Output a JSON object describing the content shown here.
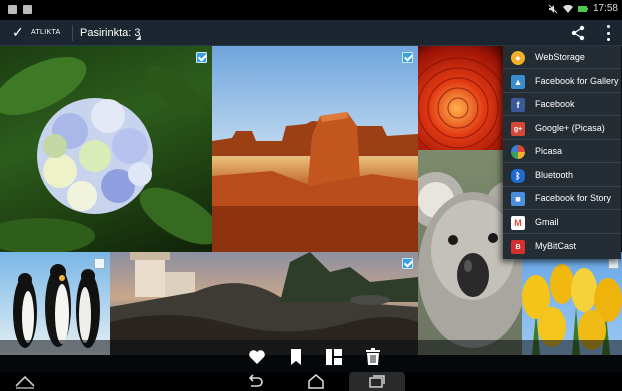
{
  "status_bar": {
    "time": "17:58"
  },
  "action_bar": {
    "done_label": "ATLIKTA",
    "selection_label": "Pasirinkta: 3"
  },
  "photos": [
    {
      "subject": "Hydrangea",
      "selected": true
    },
    {
      "subject": "Desert",
      "selected": true
    },
    {
      "subject": "Chrysanthemum",
      "selected": false
    },
    {
      "subject": "Koala",
      "selected": false
    },
    {
      "subject": "Penguins",
      "selected": false
    },
    {
      "subject": "Lighthouse",
      "selected": true
    },
    {
      "subject": "Tulips",
      "selected": false
    }
  ],
  "share_menu": {
    "items": [
      {
        "label": "WebStorage",
        "icon": "webstorage-icon",
        "color": "#f2b02a"
      },
      {
        "label": "Facebook for Gallery",
        "icon": "gallery-icon",
        "color": "#3b8ccf"
      },
      {
        "label": "Facebook",
        "icon": "facebook-icon",
        "color": "#3b5998"
      },
      {
        "label": "Google+ (Picasa)",
        "icon": "googleplus-icon",
        "color": "#d34836"
      },
      {
        "label": "Picasa",
        "icon": "picasa-icon",
        "color": "#e0433a"
      },
      {
        "label": "Bluetooth",
        "icon": "bluetooth-icon",
        "color": "#1e6ad1"
      },
      {
        "label": "Facebook for Story",
        "icon": "story-icon",
        "color": "#4a8ede"
      },
      {
        "label": "Gmail",
        "icon": "gmail-icon",
        "color": "#e04b3b"
      },
      {
        "label": "MyBitCast",
        "icon": "mybitcast-icon",
        "color": "#d62f2f"
      }
    ]
  },
  "bottom_actions": [
    "favorite-icon",
    "bookmark-icon",
    "layout-icon",
    "delete-icon"
  ],
  "navigation": [
    "menu-up-icon",
    "back-icon",
    "home-icon",
    "recents-icon"
  ]
}
